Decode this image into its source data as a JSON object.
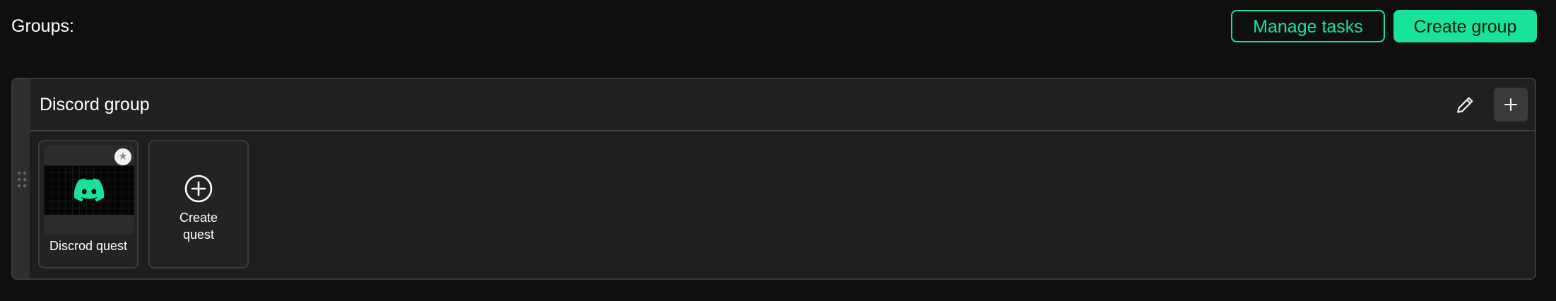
{
  "header": {
    "title": "Groups:",
    "manage_tasks_label": "Manage tasks",
    "create_group_label": "Create group"
  },
  "colors": {
    "accent": "#19e39a",
    "background": "#0f0f0f",
    "card": "#1e1e1e"
  },
  "groups": [
    {
      "name": "Discord group",
      "icons": [
        "pencil-icon",
        "plus-icon",
        "drag-handle-icon"
      ],
      "quests": [
        {
          "label": "Discrod quest",
          "icon": "discord-icon",
          "badge_icon": "star-icon",
          "badge_glyph": "★"
        }
      ],
      "create_quest": {
        "label": "Create\nquest",
        "icon": "plus-circle-icon"
      }
    }
  ]
}
